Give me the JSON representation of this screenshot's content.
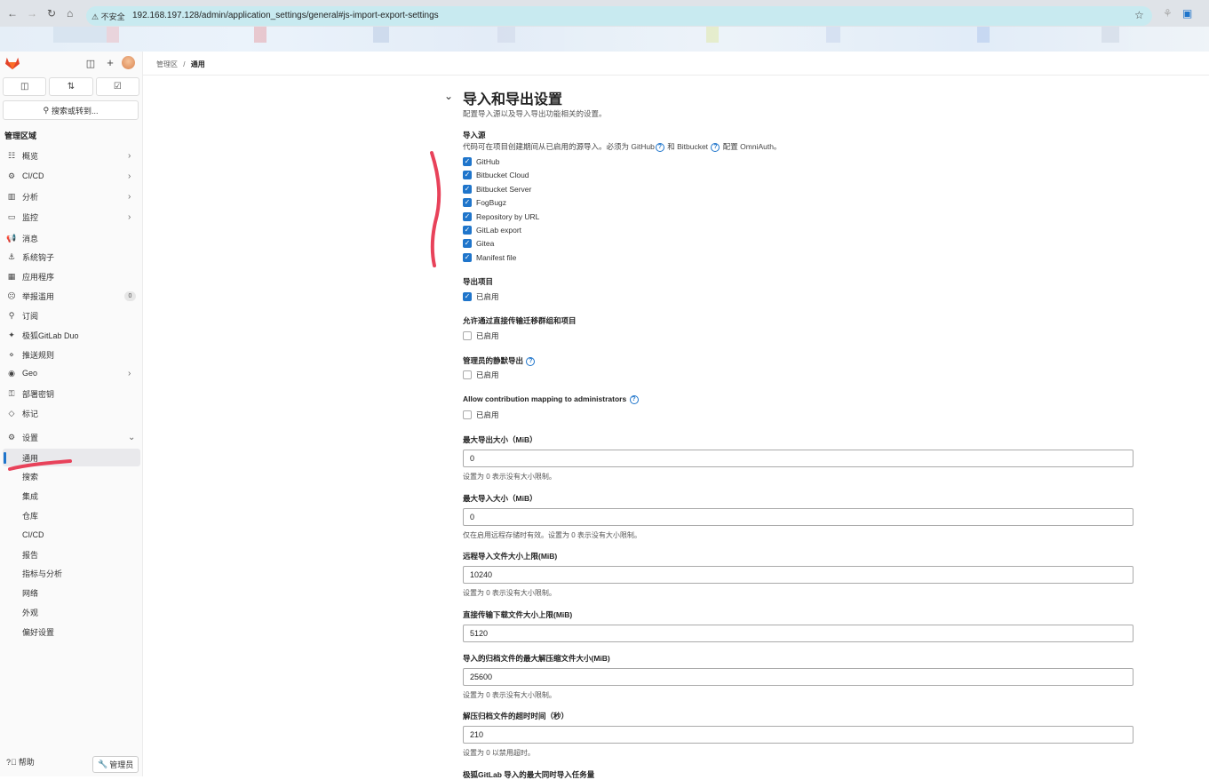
{
  "browser": {
    "insecure_label": "不安全",
    "url": "192.168.197.128/admin/application_settings/general#js-import-export-settings"
  },
  "sidebar": {
    "search_label": "搜索或转到...",
    "section_title": "管理区域",
    "items": [
      {
        "icon": "overview-icon",
        "glyph": "☷",
        "label": "概览",
        "chevron": true
      },
      {
        "icon": "cicd-icon",
        "glyph": "⚙",
        "label": "CI/CD",
        "chevron": true
      },
      {
        "icon": "analytics-icon",
        "glyph": "▥",
        "label": "分析",
        "chevron": true
      },
      {
        "icon": "monitor-icon",
        "glyph": "▭",
        "label": "监控",
        "chevron": true
      },
      {
        "icon": "messages-icon",
        "glyph": "📢",
        "label": "消息",
        "chevron": false
      },
      {
        "icon": "hook-icon",
        "glyph": "⚓",
        "label": "系统钩子",
        "chevron": false
      },
      {
        "icon": "applications-icon",
        "glyph": "▦",
        "label": "应用程序",
        "chevron": false
      },
      {
        "icon": "abuse-icon",
        "glyph": "☹",
        "label": "举报滥用",
        "chevron": false,
        "badge": "0"
      },
      {
        "icon": "subscription-icon",
        "glyph": "⚲",
        "label": "订阅",
        "chevron": false
      },
      {
        "icon": "duo-icon",
        "glyph": "✦",
        "label": "极狐GitLab Duo",
        "chevron": false
      },
      {
        "icon": "push-rules-icon",
        "glyph": "⋄",
        "label": "推送规则",
        "chevron": false
      },
      {
        "icon": "geo-icon",
        "glyph": "◉",
        "label": "Geo",
        "chevron": true
      },
      {
        "icon": "deploy-key-icon",
        "glyph": "⚿",
        "label": "部署密钥",
        "chevron": false
      },
      {
        "icon": "labels-icon",
        "glyph": "◇",
        "label": "标记",
        "chevron": false
      }
    ],
    "settings": {
      "label": "设置",
      "icon": "settings-icon"
    },
    "sub_items": [
      "通用",
      "搜索",
      "集成",
      "仓库",
      "CI/CD",
      "报告",
      "指标与分析",
      "网络",
      "外观",
      "偏好设置"
    ],
    "active_sub": "通用",
    "footer": {
      "help": "帮助",
      "admin": "管理员"
    }
  },
  "breadcrumb": {
    "root": "管理区",
    "separator": "/",
    "current": "通用"
  },
  "main": {
    "title": "导入和导出设置",
    "description": "配置导入源以及导入导出功能相关的设置。",
    "import_sources": {
      "label": "导入源",
      "desc_part1": "代码可在项目创建期间从已启用的源导入。必须为 GitHub",
      "desc_part2": "和 Bitbucket",
      "desc_part3": "配置 OmniAuth。",
      "options": [
        {
          "label": "GitHub",
          "checked": true
        },
        {
          "label": "Bitbucket Cloud",
          "checked": true
        },
        {
          "label": "Bitbucket Server",
          "checked": true
        },
        {
          "label": "FogBugz",
          "checked": true
        },
        {
          "label": "Repository by URL",
          "checked": true
        },
        {
          "label": "GitLab export",
          "checked": true
        },
        {
          "label": "Gitea",
          "checked": true
        },
        {
          "label": "Manifest file",
          "checked": true
        }
      ]
    },
    "export_project": {
      "label": "导出项目",
      "option": "已启用",
      "checked": true
    },
    "direct_transfer": {
      "label": "允许通过直接传输迁移群组和项目",
      "option": "已启用",
      "checked": false
    },
    "silent_export": {
      "label": "管理员的静默导出",
      "option": "已启用",
      "checked": false
    },
    "contribution_mapping": {
      "label": "Allow contribution mapping to administrators",
      "option": "已启用",
      "checked": false
    },
    "fields": [
      {
        "label": "最大导出大小（MiB）",
        "value": "0",
        "hint": "设置为 0 表示没有大小限制。"
      },
      {
        "label": "最大导入大小（MiB）",
        "value": "0",
        "hint": "仅在启用远程存储时有效。设置为 0 表示没有大小限制。"
      },
      {
        "label": "远程导入文件大小上限(MiB)",
        "value": "10240",
        "hint": "设置为 0 表示没有大小限制。"
      },
      {
        "label": "直接传输下载文件大小上限(MiB)",
        "value": "5120",
        "hint": ""
      },
      {
        "label": "导入的归档文件的最大解压缩文件大小(MiB)",
        "value": "25600",
        "hint": "设置为 0 表示没有大小限制。"
      },
      {
        "label": "解压归档文件的超时时间（秒）",
        "value": "210",
        "hint": "设置为 0 以禁用超时。"
      }
    ],
    "cut_label": "极狐GitLab 导入的最大同时导入任务量"
  },
  "colors": {
    "accent": "#1f75cb",
    "annotation": "#e8425a"
  }
}
